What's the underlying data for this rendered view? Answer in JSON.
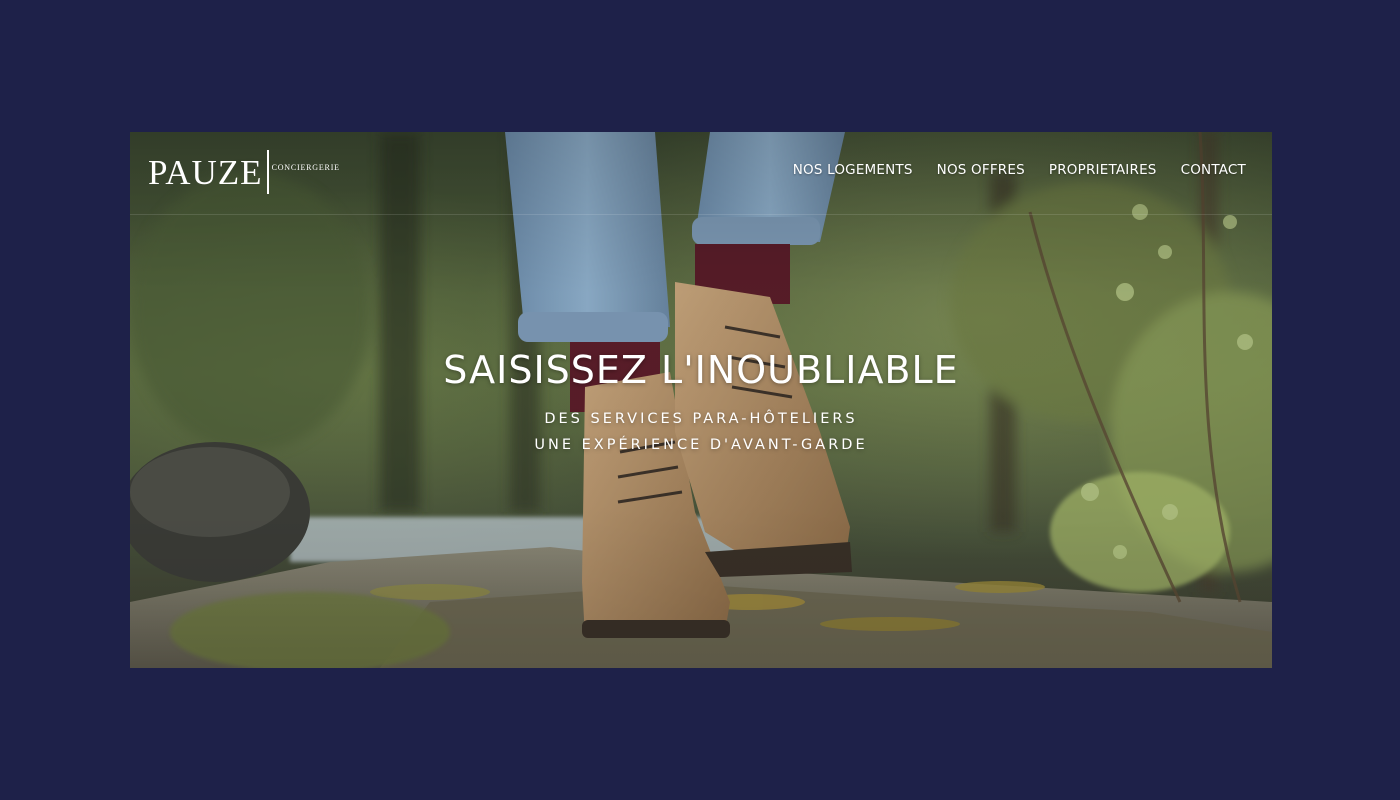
{
  "brand": {
    "name": "PAUZE",
    "tagline": "CONCIERGERIE"
  },
  "nav": {
    "items": [
      {
        "label": "NOS LOGEMENTS"
      },
      {
        "label": "NOS OFFRES"
      },
      {
        "label": "PROPRIETAIRES"
      },
      {
        "label": "CONTACT"
      }
    ]
  },
  "hero": {
    "title": "SAISISSEZ L'INOUBLIABLE",
    "subtitle_lines": [
      "DES SERVICES PARA-HÔTELIERS",
      "UNE EXPÉRIENCE D'AVANT-GARDE"
    ],
    "image": "hiker-boots-on-forest-rock"
  },
  "colors": {
    "page_background": "#1e2149",
    "text": "#ffffff"
  }
}
